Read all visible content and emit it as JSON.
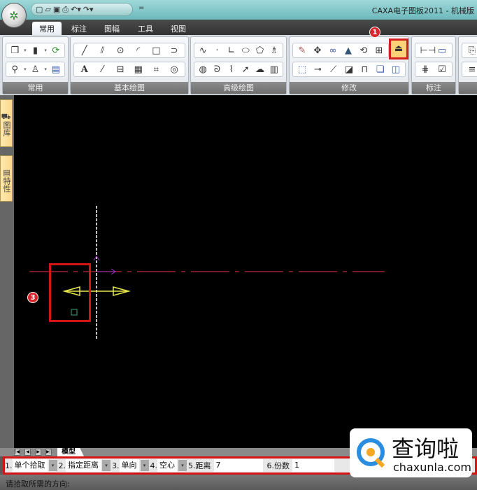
{
  "title_bar": {
    "app_title": "CAXA电子图板2011 - 机械版",
    "app_button_icon": "caxa-logo-icon",
    "quick_access": [
      "new-file-icon",
      "open-folder-icon",
      "save-icon",
      "print-icon",
      "undo-icon",
      "redo-icon"
    ],
    "customize": "="
  },
  "tabs": [
    {
      "label": "常用",
      "active": true
    },
    {
      "label": "标注"
    },
    {
      "label": "图幅"
    },
    {
      "label": "工具"
    },
    {
      "label": "视图"
    }
  ],
  "ribbon": {
    "groups": [
      {
        "label": "常用",
        "row1": [
          "copy-icon",
          "paste-icon",
          "refresh-icon"
        ],
        "row2": [
          "zoom-icon",
          "match-properties-icon",
          "layer-icon"
        ]
      },
      {
        "label": "基本绘图",
        "row1": [
          "line-icon",
          "parallel-line-icon",
          "circle-icon",
          "arc-icon",
          "rectangle-icon",
          "polyline-icon"
        ],
        "row2": [
          "text-icon",
          "centerline-icon",
          "block-icon",
          "hatch-icon",
          "boundary-icon",
          "region-icon"
        ]
      },
      {
        "label": "高级绘图",
        "row1": [
          "spline-icon",
          "point-icon",
          "angle-icon",
          "ellipse-icon",
          "polygon-icon",
          "pattern-icon"
        ],
        "row2": [
          "hole-icon",
          "wave-icon",
          "break-line-icon",
          "arrow-icon",
          "cloud-icon",
          "table-icon"
        ]
      },
      {
        "label": "修改",
        "row1": [
          "erase-icon",
          "move-icon",
          "copy-object-icon",
          "mirror-icon",
          "rotate-icon",
          "array-icon",
          "offset-icon"
        ],
        "row2": [
          "select-icon",
          "trim-icon",
          "extend-icon",
          "scale-icon",
          "break-icon",
          "explode-icon",
          "stretch-icon"
        ]
      },
      {
        "label": "标注",
        "row1": [
          "dimension-icon",
          "text-dim-icon"
        ],
        "row2": [
          "coordinate-icon",
          "edit-dim-icon"
        ]
      }
    ]
  },
  "annotations": {
    "badge_1": "1",
    "badge_3": "3"
  },
  "side_tabs": [
    "图库",
    "特性"
  ],
  "model_tab": "模型",
  "command_bar": {
    "options": [
      {
        "num": "1.",
        "value": "单个拾取"
      },
      {
        "num": "2.",
        "value": "指定距离"
      },
      {
        "num": "3.",
        "value": "单向"
      },
      {
        "num": "4.",
        "value": "空心"
      }
    ],
    "distance_label": "5.距离",
    "distance_value": "7",
    "count_label": "6.份数",
    "count_value": "1"
  },
  "status_prompt": "请拾取所需的方向:",
  "watermark": {
    "brand": "查询啦",
    "url": "chaxunla.com"
  },
  "colors": {
    "canvas": "#000000",
    "centerline": "#c0283c",
    "highlight": "#d41515",
    "arrow": "#e8e84a",
    "axis": "#a030c0"
  }
}
